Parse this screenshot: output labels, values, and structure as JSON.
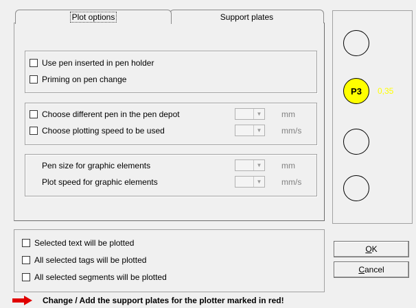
{
  "tabs": [
    {
      "label": "Plot options"
    },
    {
      "label": "Support plates"
    }
  ],
  "pen_holder_group": {
    "items": [
      {
        "label": "Use pen inserted in pen holder",
        "checked": false
      },
      {
        "label": "Priming on pen change",
        "checked": false
      }
    ]
  },
  "pen_depot_group": {
    "items": [
      {
        "label": "Choose different pen in the pen depot",
        "checked": false,
        "unit": "mm",
        "value": ""
      },
      {
        "label": "Choose plotting speed to be used",
        "checked": false,
        "unit": "mm/s",
        "value": ""
      }
    ]
  },
  "graphic_group": {
    "items": [
      {
        "label": "Pen size for graphic elements",
        "unit": "mm",
        "value": ""
      },
      {
        "label": "Plot speed for graphic elements",
        "unit": "mm/s",
        "value": ""
      }
    ]
  },
  "pens": [
    {
      "label": "",
      "value": ""
    },
    {
      "label": "P3",
      "value": "0,35",
      "active_color": "#ffff00"
    },
    {
      "label": "",
      "value": ""
    },
    {
      "label": "",
      "value": ""
    }
  ],
  "bottom_options": [
    {
      "label": "Selected text will be plotted",
      "checked": false
    },
    {
      "label": "All selected tags will be plotted",
      "checked": false
    },
    {
      "label": "All selected segments will be plotted",
      "checked": false
    }
  ],
  "buttons": {
    "ok": {
      "mnemonic": "O",
      "rest": "K"
    },
    "cancel": {
      "mnemonic": "C",
      "rest": "ancel"
    }
  },
  "footer": {
    "message": "Change / Add the support plates for the plotter marked in red!",
    "arrow_color": "#e00000"
  },
  "colors": {
    "background": "#f0f0f0",
    "active_pen": "#ffff00",
    "pen_value_text": "#ffff00",
    "warning_arrow": "#e00000"
  }
}
